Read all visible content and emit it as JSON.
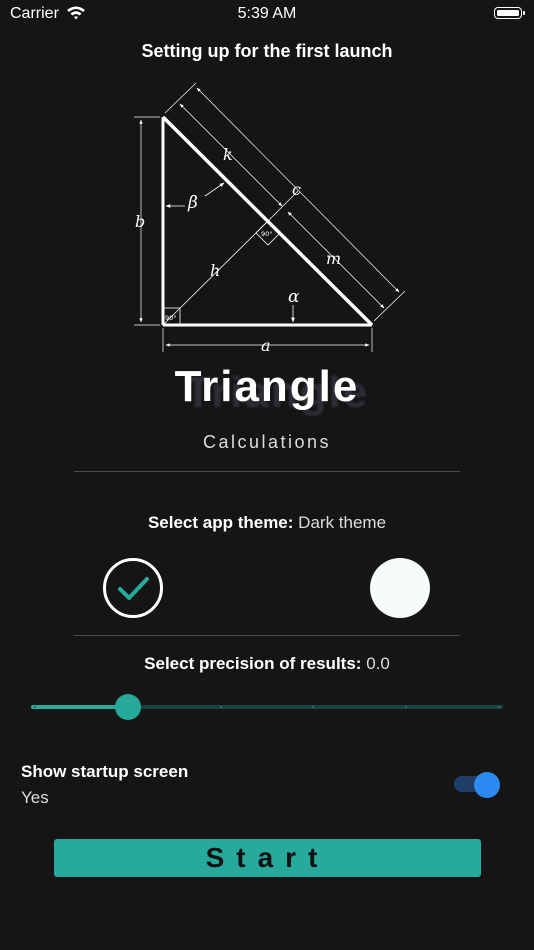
{
  "status_bar": {
    "carrier": "Carrier",
    "time": "5:39 AM",
    "icons": [
      "wifi-icon",
      "battery-icon"
    ]
  },
  "setup": {
    "title": "Setting up for the first launch"
  },
  "diagram": {
    "labels": {
      "side_a": "a",
      "side_b": "b",
      "side_c": "c",
      "height": "h",
      "segment_k": "k",
      "segment_m": "m",
      "angle_alpha": "α",
      "angle_beta": "β",
      "right_angle_1": "90°",
      "right_angle_2": "90°"
    },
    "colors": {
      "lines": "#ffffff"
    }
  },
  "app": {
    "title": "Triangle",
    "subtitle": "Calculations"
  },
  "theme": {
    "label": "Select app theme:",
    "value": "Dark theme",
    "options": [
      {
        "name": "dark",
        "selected": true,
        "icon": "check-icon"
      },
      {
        "name": "light",
        "selected": false
      }
    ]
  },
  "precision": {
    "label": "Select precision of results:",
    "value": "0.0",
    "slider": {
      "min": 0,
      "max": 5,
      "current": 1
    }
  },
  "startup": {
    "label": "Show startup screen",
    "value": "Yes",
    "toggle_on": true
  },
  "start_button": {
    "label": "Start"
  },
  "colors": {
    "background": "#151515",
    "accent": "#27a99b",
    "toggle_accent": "#2a8af0",
    "text": "#ffffff"
  }
}
